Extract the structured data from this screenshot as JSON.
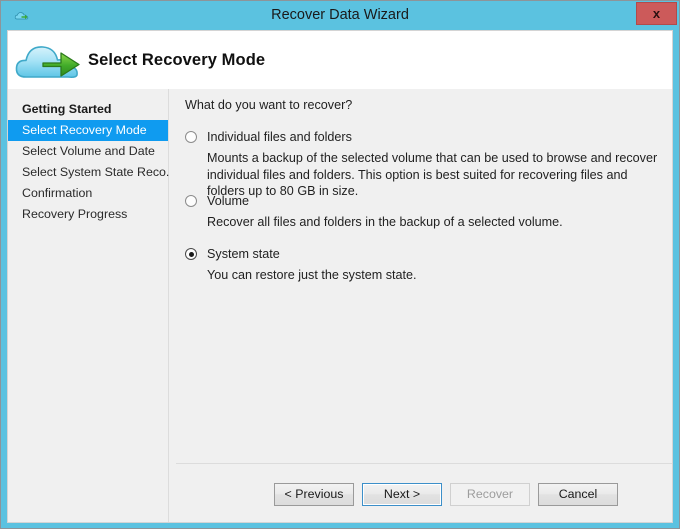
{
  "window": {
    "title": "Recover Data Wizard",
    "title_icon": "cloud-icon",
    "close_label": "x",
    "accent_color": "#5bc2e0",
    "close_color": "#cc5a5a"
  },
  "banner": {
    "icon": "cloud-with-arrow-icon",
    "heading": "Select Recovery Mode"
  },
  "sidebar": {
    "selected_color": "#0f9bf0",
    "items": [
      {
        "label": "Getting Started",
        "state": "completed"
      },
      {
        "label": "Select Recovery Mode",
        "state": "selected"
      },
      {
        "label": "Select Volume and Date",
        "state": "normal"
      },
      {
        "label": "Select System State Reco...",
        "state": "normal"
      },
      {
        "label": "Confirmation",
        "state": "normal"
      },
      {
        "label": "Recovery Progress",
        "state": "normal"
      }
    ]
  },
  "main": {
    "question": "What do you want to recover?",
    "options": [
      {
        "label": "Individual files and folders",
        "description": "Mounts a backup of the selected volume that can be used to browse and recover individual files and folders. This option is best suited for recovering files and folders up to 80 GB in size.",
        "selected": false
      },
      {
        "label": "Volume",
        "description": "Recover all files and folders in the backup of a selected volume.",
        "selected": false
      },
      {
        "label": "System state",
        "description": "You can restore just the system state.",
        "selected": true
      }
    ]
  },
  "buttons": {
    "previous": {
      "label": "< Previous",
      "enabled": true,
      "focused": false
    },
    "next": {
      "label": "Next >",
      "enabled": true,
      "focused": true
    },
    "recover": {
      "label": "Recover",
      "enabled": false,
      "focused": false
    },
    "cancel": {
      "label": "Cancel",
      "enabled": true,
      "focused": false
    }
  }
}
